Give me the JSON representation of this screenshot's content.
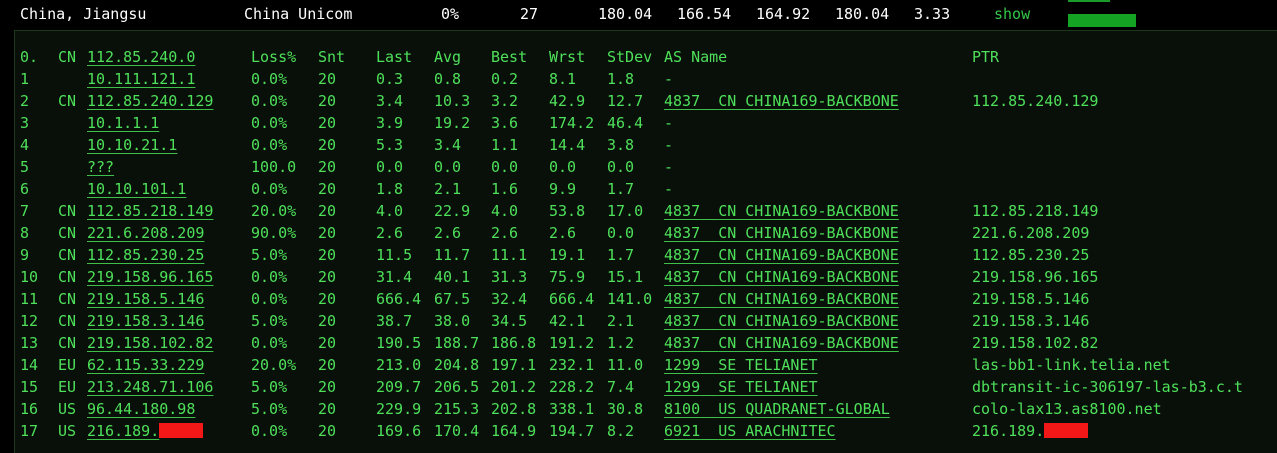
{
  "summary": {
    "location": "China, Jiangsu",
    "isp": "China Unicom",
    "loss": "0%",
    "sent": "27",
    "last": "180.04",
    "avg": "166.54",
    "best": "164.92",
    "worst": "180.04",
    "stdev": "3.33",
    "action": "show",
    "colors": {
      "bar": "#14a323",
      "text": "#4ee05a",
      "background": "#091009"
    }
  },
  "headers": {
    "hop": "0.",
    "cc": "CN",
    "host": "112.85.240.0",
    "loss": "Loss%",
    "snt": "Snt",
    "last": "Last",
    "avg": "Avg",
    "best": "Best",
    "wrst": "Wrst",
    "stdev": "StDev",
    "asname": "AS Name",
    "ptr": "PTR"
  },
  "hops": [
    {
      "n": "1",
      "cc": "",
      "host": "10.111.121.1",
      "loss": "0.0%",
      "snt": "20",
      "last": "0.3",
      "avg": "0.8",
      "best": "0.2",
      "wrst": "8.1",
      "stdev": "1.8",
      "asn": "-",
      "as": "",
      "ptr": ""
    },
    {
      "n": "2",
      "cc": "CN",
      "host": "112.85.240.129",
      "loss": "0.0%",
      "snt": "20",
      "last": "3.4",
      "avg": "10.3",
      "best": "3.2",
      "wrst": "42.9",
      "stdev": "12.7",
      "asn": "4837",
      "as": "CN CHINA169-BACKBONE",
      "ptr": "112.85.240.129"
    },
    {
      "n": "3",
      "cc": "",
      "host": "10.1.1.1",
      "loss": "0.0%",
      "snt": "20",
      "last": "3.9",
      "avg": "19.2",
      "best": "3.6",
      "wrst": "174.2",
      "stdev": "46.4",
      "asn": "-",
      "as": "",
      "ptr": ""
    },
    {
      "n": "4",
      "cc": "",
      "host": "10.10.21.1",
      "loss": "0.0%",
      "snt": "20",
      "last": "5.3",
      "avg": "3.4",
      "best": "1.1",
      "wrst": "14.4",
      "stdev": "3.8",
      "asn": "-",
      "as": "",
      "ptr": ""
    },
    {
      "n": "5",
      "cc": "",
      "host": "???",
      "loss": "100.0",
      "snt": "20",
      "last": "0.0",
      "avg": "0.0",
      "best": "0.0",
      "wrst": "0.0",
      "stdev": "0.0",
      "asn": "-",
      "as": "",
      "ptr": ""
    },
    {
      "n": "6",
      "cc": "",
      "host": "10.10.101.1",
      "loss": "0.0%",
      "snt": "20",
      "last": "1.8",
      "avg": "2.1",
      "best": "1.6",
      "wrst": "9.9",
      "stdev": "1.7",
      "asn": "-",
      "as": "",
      "ptr": ""
    },
    {
      "n": "7",
      "cc": "CN",
      "host": "112.85.218.149",
      "loss": "20.0%",
      "snt": "20",
      "last": "4.0",
      "avg": "22.9",
      "best": "4.0",
      "wrst": "53.8",
      "stdev": "17.0",
      "asn": "4837",
      "as": "CN CHINA169-BACKBONE",
      "ptr": "112.85.218.149"
    },
    {
      "n": "8",
      "cc": "CN",
      "host": "221.6.208.209",
      "loss": "90.0%",
      "snt": "20",
      "last": "2.6",
      "avg": "2.6",
      "best": "2.6",
      "wrst": "2.6",
      "stdev": "0.0",
      "asn": "4837",
      "as": "CN CHINA169-BACKBONE",
      "ptr": "221.6.208.209"
    },
    {
      "n": "9",
      "cc": "CN",
      "host": "112.85.230.25",
      "loss": "5.0%",
      "snt": "20",
      "last": "11.5",
      "avg": "11.7",
      "best": "11.1",
      "wrst": "19.1",
      "stdev": "1.7",
      "asn": "4837",
      "as": "CN CHINA169-BACKBONE",
      "ptr": "112.85.230.25"
    },
    {
      "n": "10",
      "cc": "CN",
      "host": "219.158.96.165",
      "loss": "0.0%",
      "snt": "20",
      "last": "31.4",
      "avg": "40.1",
      "best": "31.3",
      "wrst": "75.9",
      "stdev": "15.1",
      "asn": "4837",
      "as": "CN CHINA169-BACKBONE",
      "ptr": "219.158.96.165"
    },
    {
      "n": "11",
      "cc": "CN",
      "host": "219.158.5.146",
      "loss": "0.0%",
      "snt": "20",
      "last": "666.4",
      "avg": "67.5",
      "best": "32.4",
      "wrst": "666.4",
      "stdev": "141.0",
      "asn": "4837",
      "as": "CN CHINA169-BACKBONE",
      "ptr": "219.158.5.146"
    },
    {
      "n": "12",
      "cc": "CN",
      "host": "219.158.3.146",
      "loss": "5.0%",
      "snt": "20",
      "last": "38.7",
      "avg": "38.0",
      "best": "34.5",
      "wrst": "42.1",
      "stdev": "2.1",
      "asn": "4837",
      "as": "CN CHINA169-BACKBONE",
      "ptr": "219.158.3.146"
    },
    {
      "n": "13",
      "cc": "CN",
      "host": "219.158.102.82",
      "loss": "0.0%",
      "snt": "20",
      "last": "190.5",
      "avg": "188.7",
      "best": "186.8",
      "wrst": "191.2",
      "stdev": "1.2",
      "asn": "4837",
      "as": "CN CHINA169-BACKBONE",
      "ptr": "219.158.102.82"
    },
    {
      "n": "14",
      "cc": "EU",
      "host": "62.115.33.229",
      "loss": "20.0%",
      "snt": "20",
      "last": "213.0",
      "avg": "204.8",
      "best": "197.1",
      "wrst": "232.1",
      "stdev": "11.0",
      "asn": "1299",
      "as": "SE TELIANET",
      "ptr": "las-bb1-link.telia.net"
    },
    {
      "n": "15",
      "cc": "EU",
      "host": "213.248.71.106",
      "loss": "5.0%",
      "snt": "20",
      "last": "209.7",
      "avg": "206.5",
      "best": "201.2",
      "wrst": "228.2",
      "stdev": "7.4",
      "asn": "1299",
      "as": "SE TELIANET",
      "ptr": "dbtransit-ic-306197-las-b3.c.t"
    },
    {
      "n": "16",
      "cc": "US",
      "host": "96.44.180.98",
      "loss": "5.0%",
      "snt": "20",
      "last": "229.9",
      "avg": "215.3",
      "best": "202.8",
      "wrst": "338.1",
      "stdev": "30.8",
      "asn": "8100",
      "as": "US QUADRANET-GLOBAL",
      "ptr": "colo-lax13.as8100.net"
    },
    {
      "n": "17",
      "cc": "US",
      "host": "216.189.",
      "loss": "0.0%",
      "snt": "20",
      "last": "169.6",
      "avg": "170.4",
      "best": "164.9",
      "wrst": "194.7",
      "stdev": "8.2",
      "asn": "6921",
      "as": "US ARACHNITEC",
      "ptr": "216.189.",
      "redacted": true
    }
  ]
}
